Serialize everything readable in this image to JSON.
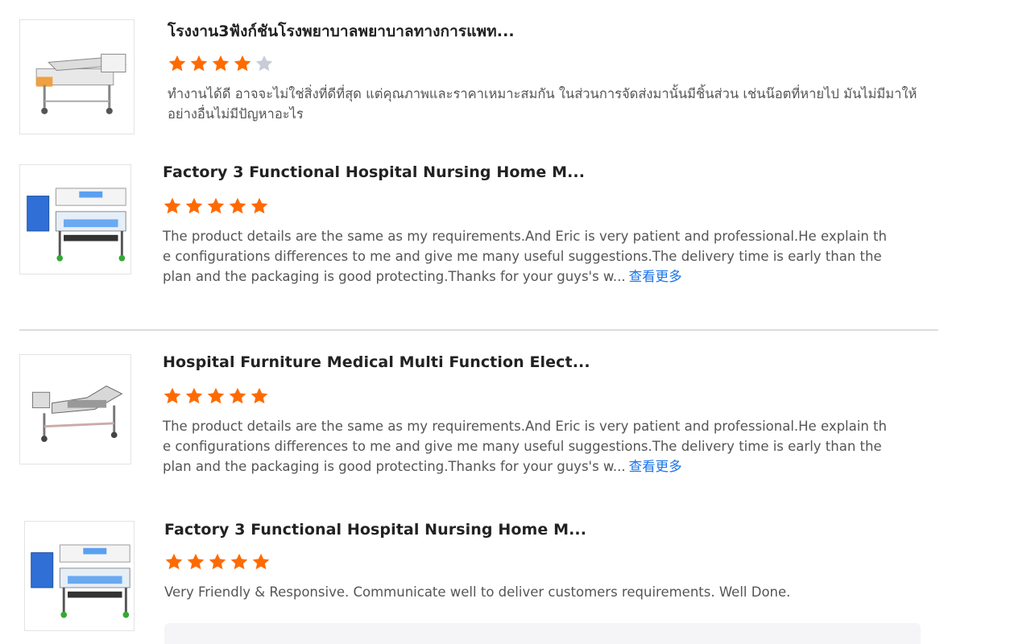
{
  "colors": {
    "star_filled": "#ff6a00",
    "star_empty": "#c9ccd6",
    "link": "#1a73e8"
  },
  "reviews": [
    {
      "title": "โรงงาน3ฟังก์ชันโรงพยาบาลพยาบาลทางการแพท...",
      "rating": 4,
      "rating_max": 5,
      "text": "ทำงานได้ดี อาจจะไม่ใช่สิ่งที่ดีที่สุด แต่คุณภาพและราคาเหมาะสมกัน  ในส่วนการจัดส่งมานั้นมีชิ้นส่วน เช่นน๊อตที่หายไป มันไม่มีมาให้ อย่างอื่นไม่มีปัญหาอะไร",
      "more": "",
      "image": "hospital-bed-beige-icon"
    },
    {
      "title": "Factory 3 Functional Hospital Nursing Home M...",
      "rating": 5,
      "rating_max": 5,
      "text": "The product details are the same as my requirements.And Eric is very patient and professional.He explain the configurations differences to me and give me many useful suggestions.The delivery time is early than the plan and the packaging is good protecting.Thanks for your guys's w...",
      "more": "查看更多",
      "image": "hospital-bed-blue-icon"
    },
    {
      "title": "Hospital Furniture Medical Multi Function Elect...",
      "rating": 5,
      "rating_max": 5,
      "text": "The product details are the same as my requirements.And Eric is very patient and professional.He explain the configurations differences to me and give me many useful suggestions.The delivery time is early than the plan and the packaging is good protecting.Thanks for your guys's w...",
      "more": "查看更多",
      "image": "hospital-bed-electric-icon"
    },
    {
      "title": "Factory 3 Functional Hospital Nursing Home M...",
      "rating": 5,
      "rating_max": 5,
      "text": "Very Friendly & Responsive. Communicate well to deliver customers requirements. Well Done.",
      "more": "",
      "image": "hospital-bed-blue-icon"
    }
  ]
}
